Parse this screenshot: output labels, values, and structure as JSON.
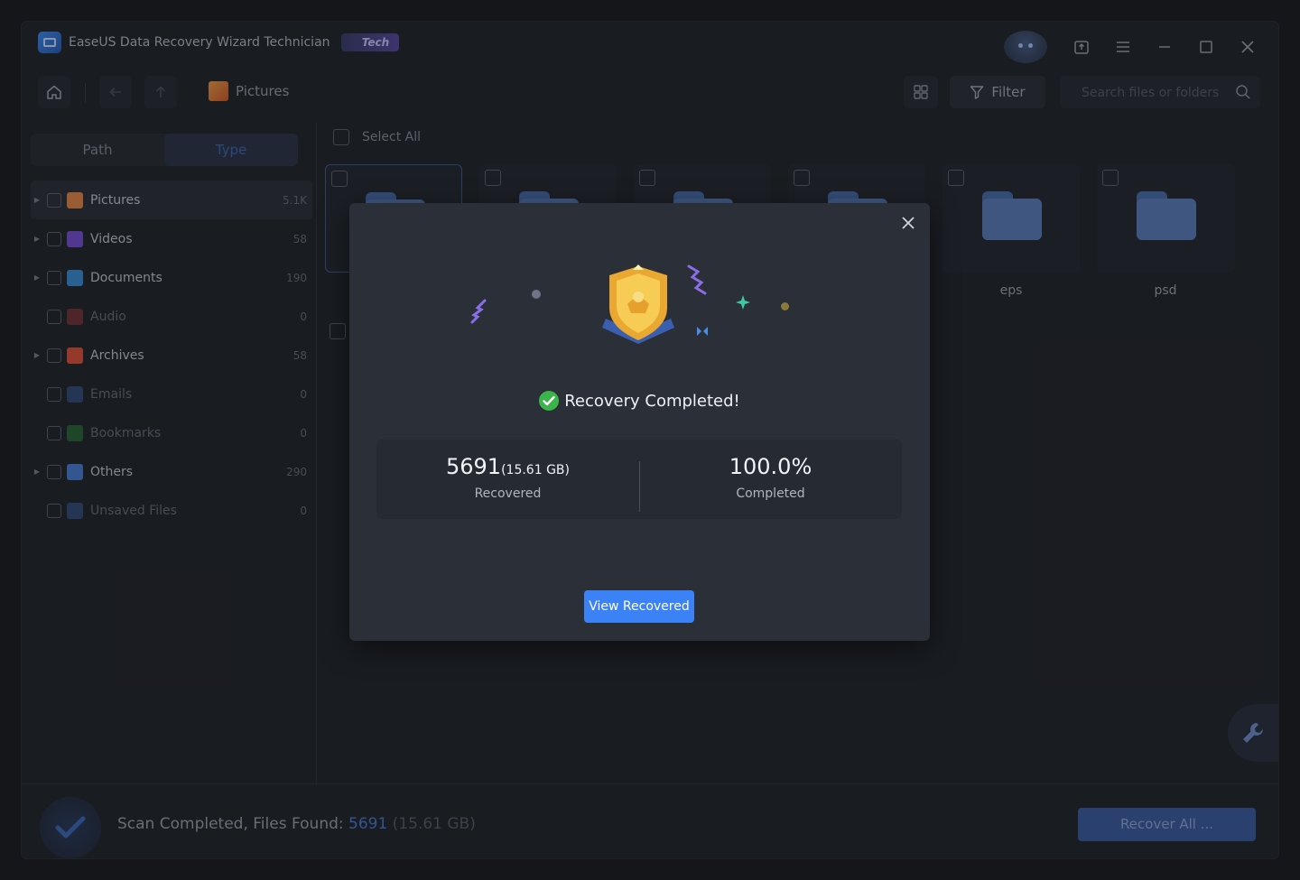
{
  "app": {
    "title": "EaseUS Data Recovery Wizard Technician",
    "badge": "Tech"
  },
  "nav": {
    "breadcrumb": "Pictures",
    "filter_label": "Filter",
    "search_placeholder": "Search files or folders"
  },
  "sidebar": {
    "tabs": [
      {
        "label": "Path",
        "active": false
      },
      {
        "label": "Type",
        "active": true
      }
    ],
    "categories": [
      {
        "label": "Pictures",
        "count": "5.1K",
        "icon_color": "#e8874a"
      },
      {
        "label": "Videos",
        "count": "58",
        "icon_color": "#7a4fd6"
      },
      {
        "label": "Documents",
        "count": "190",
        "icon_color": "#3a8fd8"
      },
      {
        "label": "Audio",
        "count": "0",
        "icon_color": "#d64a4a"
      },
      {
        "label": "Archives",
        "count": "58",
        "icon_color": "#e0523a"
      },
      {
        "label": "Emails",
        "count": "0",
        "icon_color": "#4a7fd6"
      },
      {
        "label": "Bookmarks",
        "count": "0",
        "icon_color": "#3bb54a"
      },
      {
        "label": "Others",
        "count": "290",
        "icon_color": "#4a7fd6"
      },
      {
        "label": "Unsaved Files",
        "count": "0",
        "icon_color": "#4a7fd6"
      }
    ]
  },
  "content": {
    "select_all": "Select All",
    "folders": [
      "eps",
      "psd"
    ]
  },
  "footer": {
    "status_prefix": "Scan Completed, Files Found: ",
    "count": "5691",
    "size": " (15.61 GB)",
    "recover_label": "Recover All ..."
  },
  "modal": {
    "title": "Recovery Completed!",
    "recovered_value": "5691",
    "recovered_size": "(15.61 GB)",
    "recovered_label": "Recovered",
    "completed_value": "100.0%",
    "completed_label": "Completed",
    "button_label": "View Recovered"
  },
  "colors": {
    "accent": "#3b82f6",
    "success": "#3bb54a"
  }
}
